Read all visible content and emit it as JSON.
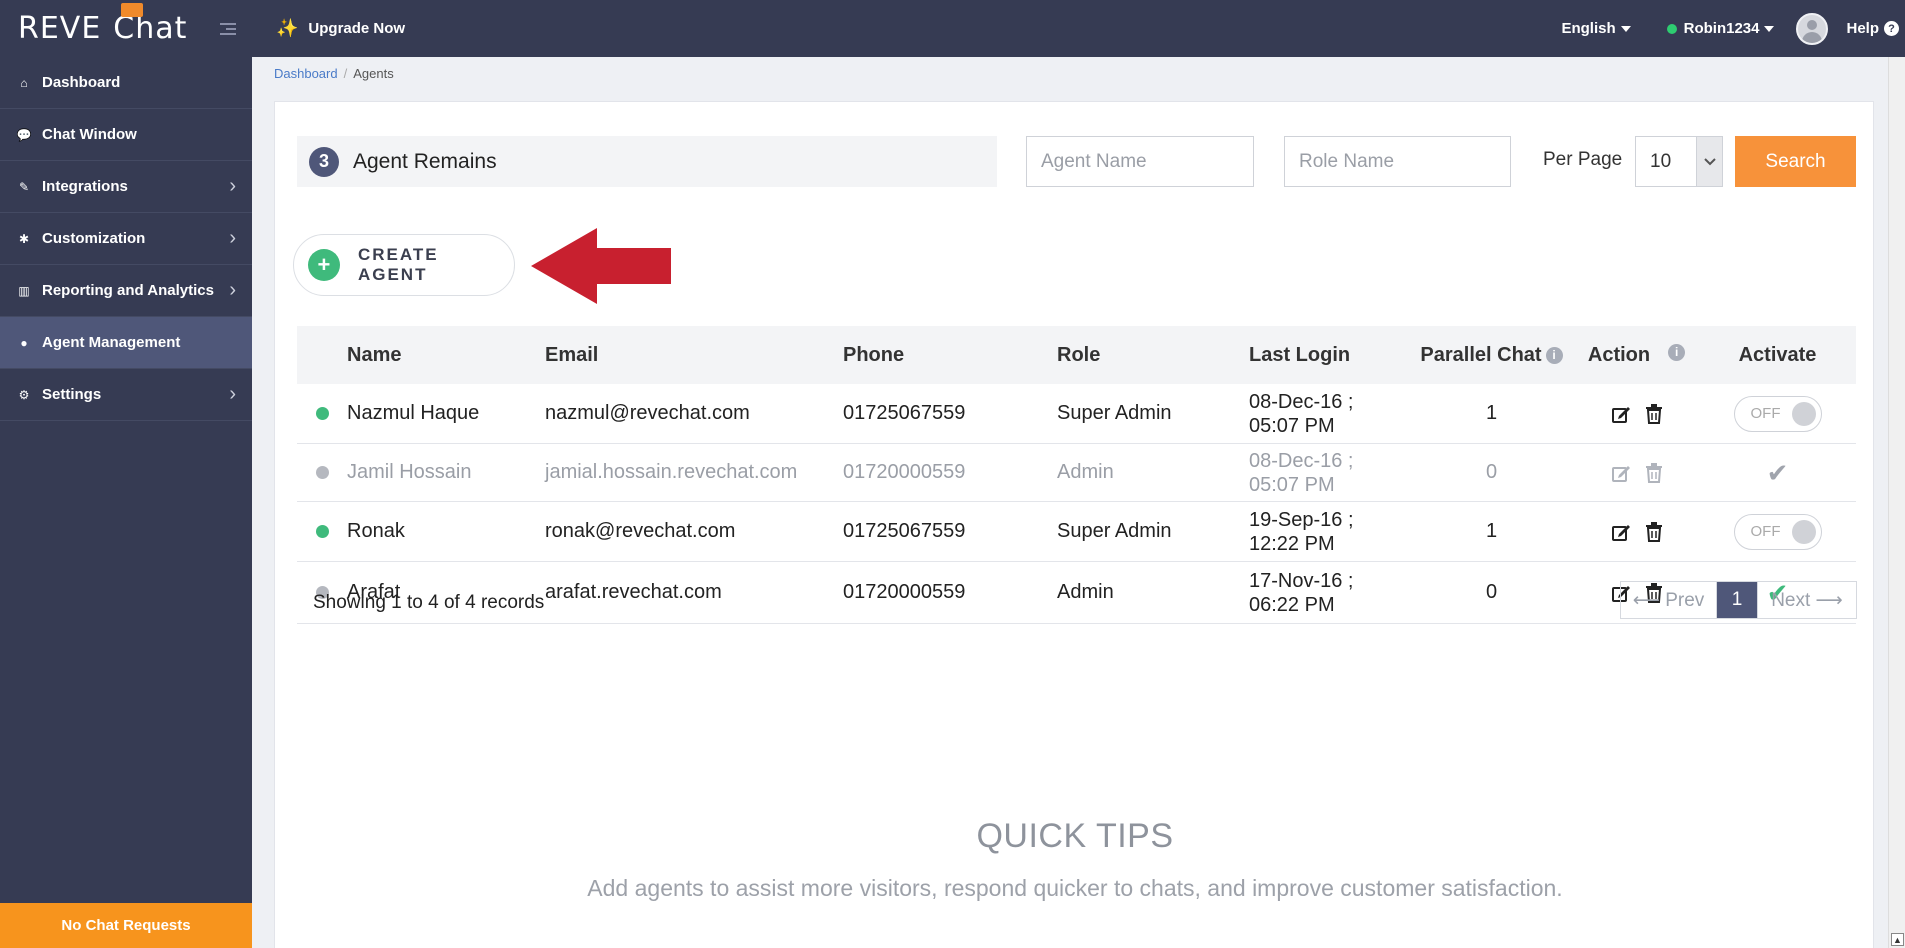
{
  "brand": {
    "logo_text": "REVE",
    "logo_chat": "Chat"
  },
  "sidebar": {
    "items": [
      {
        "label": "Dashboard",
        "icon": "home-icon",
        "chevron": false,
        "active": false
      },
      {
        "label": "Chat Window",
        "icon": "chat-icon",
        "chevron": false,
        "active": false
      },
      {
        "label": "Integrations",
        "icon": "plug-icon",
        "chevron": true,
        "active": false
      },
      {
        "label": "Customization",
        "icon": "gear-icon",
        "chevron": true,
        "active": false
      },
      {
        "label": "Reporting and Analytics",
        "icon": "bar-chart-icon",
        "chevron": true,
        "active": false
      },
      {
        "label": "Agent Management",
        "icon": "user-icon",
        "chevron": false,
        "active": true
      },
      {
        "label": "Settings",
        "icon": "gears-icon",
        "chevron": true,
        "active": false
      }
    ],
    "footer": "No Chat Requests"
  },
  "topbar": {
    "upgrade": "Upgrade Now",
    "language": "English",
    "user": "Robin1234",
    "help": "Help",
    "help_glyph": "?"
  },
  "breadcrumb": {
    "root": "Dashboard",
    "current": "Agents"
  },
  "summary": {
    "count": "3",
    "label": "Agent Remains"
  },
  "filters": {
    "agent_name_placeholder": "Agent Name",
    "role_name_placeholder": "Role Name",
    "per_page_label": "Per Page",
    "per_page_value": "10",
    "search_label": "Search"
  },
  "create_agent": {
    "label": "CREATE AGENT",
    "glyph": "+"
  },
  "table": {
    "headers": {
      "name": "Name",
      "email": "Email",
      "phone": "Phone",
      "role": "Role",
      "last_login": "Last Login",
      "parallel_chat": "Parallel Chat",
      "action": "Action",
      "activate": "Activate"
    },
    "rows": [
      {
        "name": "Nazmul Haque",
        "email": "nazmul@revechat.com",
        "phone": "01725067559",
        "role": "Super Admin",
        "login_date": "08-Dec-16 ;",
        "login_time": "05:07 PM",
        "parallel": "1",
        "online": true,
        "dim": false,
        "activate": "toggle",
        "toggle_label": "OFF"
      },
      {
        "name": "Jamil Hossain",
        "email": "jamial.hossain.revechat.com",
        "phone": "01720000559",
        "role": "Admin",
        "login_date": "08-Dec-16 ;",
        "login_time": "05:07 PM",
        "parallel": "0",
        "online": false,
        "dim": true,
        "activate": "check-grey",
        "toggle_label": ""
      },
      {
        "name": "Ronak",
        "email": "ronak@revechat.com",
        "phone": "01725067559",
        "role": "Super Admin",
        "login_date": "19-Sep-16 ;",
        "login_time": "12:22 PM",
        "parallel": "1",
        "online": true,
        "dim": false,
        "activate": "toggle",
        "toggle_label": "OFF"
      },
      {
        "name": "Arafat",
        "email": "arafat.revechat.com",
        "phone": "01720000559",
        "role": "Admin",
        "login_date": "17-Nov-16 ;",
        "login_time": "06:22 PM",
        "parallel": "0",
        "online": false,
        "dim": false,
        "activate": "check-green",
        "toggle_label": ""
      }
    ]
  },
  "records_text": "Showing 1 to 4 of 4 records",
  "pagination": {
    "prev": "⟵ Prev",
    "current": "1",
    "next": "Next ⟶"
  },
  "quick_tips": {
    "title": "QUICK TIPS",
    "text": "Add agents to assist more visitors, respond quicker to chats, and improve customer satisfaction."
  },
  "colors": {
    "sidebar": "#363b53",
    "accent_orange": "#f7923a",
    "online_green": "#3fba7c",
    "arrow_red": "#c8202f"
  }
}
